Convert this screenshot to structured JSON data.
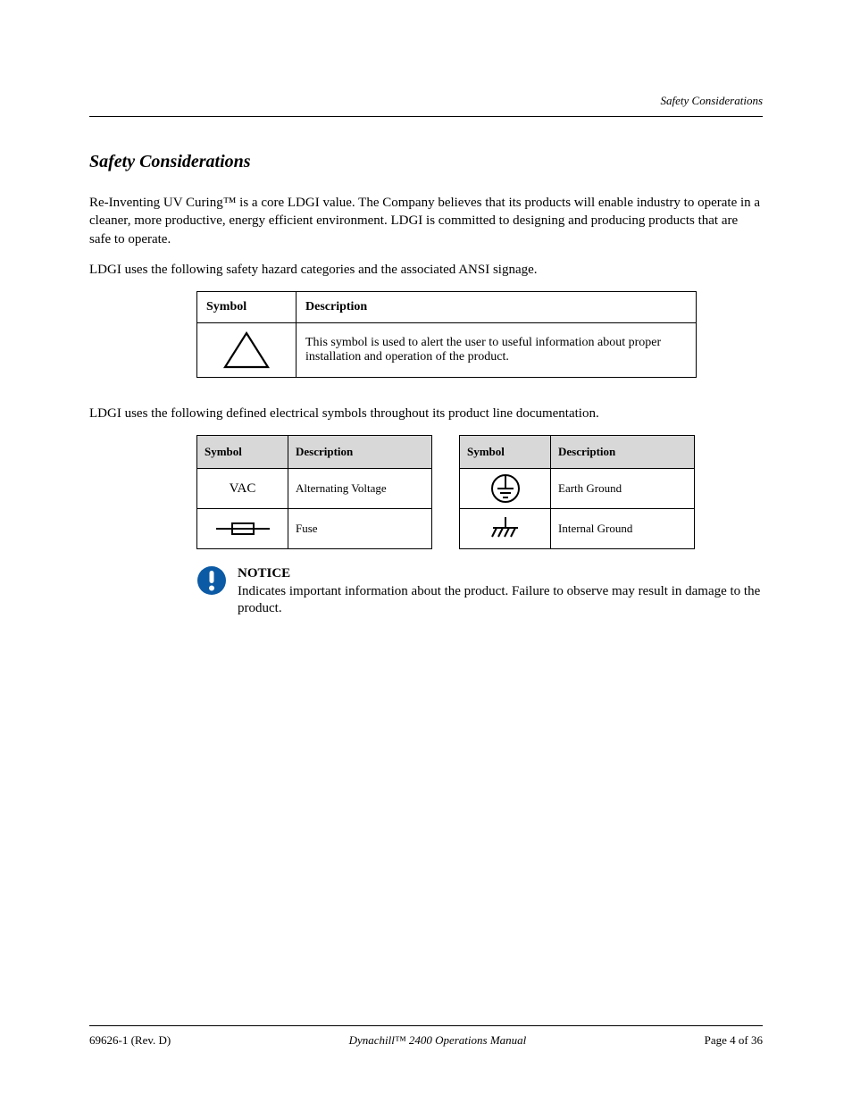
{
  "header": {
    "label": "Safety Considerations"
  },
  "section": {
    "title": "Safety Considerations",
    "para1": "Re-Inventing UV Curing™ is a core LDGI value. The Company believes that its products will enable industry to operate in a cleaner, more productive, energy efficient environment. LDGI is committed to designing and producing products that are safe to operate.",
    "para2": "LDGI uses the following safety hazard categories and the associated ANSI signage.",
    "para3": "LDGI uses the following defined electrical symbols throughout its product line documentation."
  },
  "table1": {
    "headers": [
      "Symbol",
      "Description"
    ],
    "row1_desc": "This symbol is used to alert the user to useful information about proper installation and operation of the product."
  },
  "table2": {
    "headers": [
      "Symbol",
      "Description"
    ],
    "row1_symbol_text": "VAC",
    "row1_desc": "Alternating Voltage",
    "row2_desc": "Fuse"
  },
  "table3": {
    "headers": [
      "Symbol",
      "Description"
    ],
    "row1_desc": "Earth Ground",
    "row2_desc": "Internal Ground"
  },
  "notice": {
    "heading": "NOTICE",
    "text": "Indicates important information about the product. Failure to observe may result in damage to the product."
  },
  "footer": {
    "left": "69626-1 (Rev. D)",
    "center": "Dynachill™ 2400 Operations Manual",
    "right": "Page 4 of 36"
  }
}
